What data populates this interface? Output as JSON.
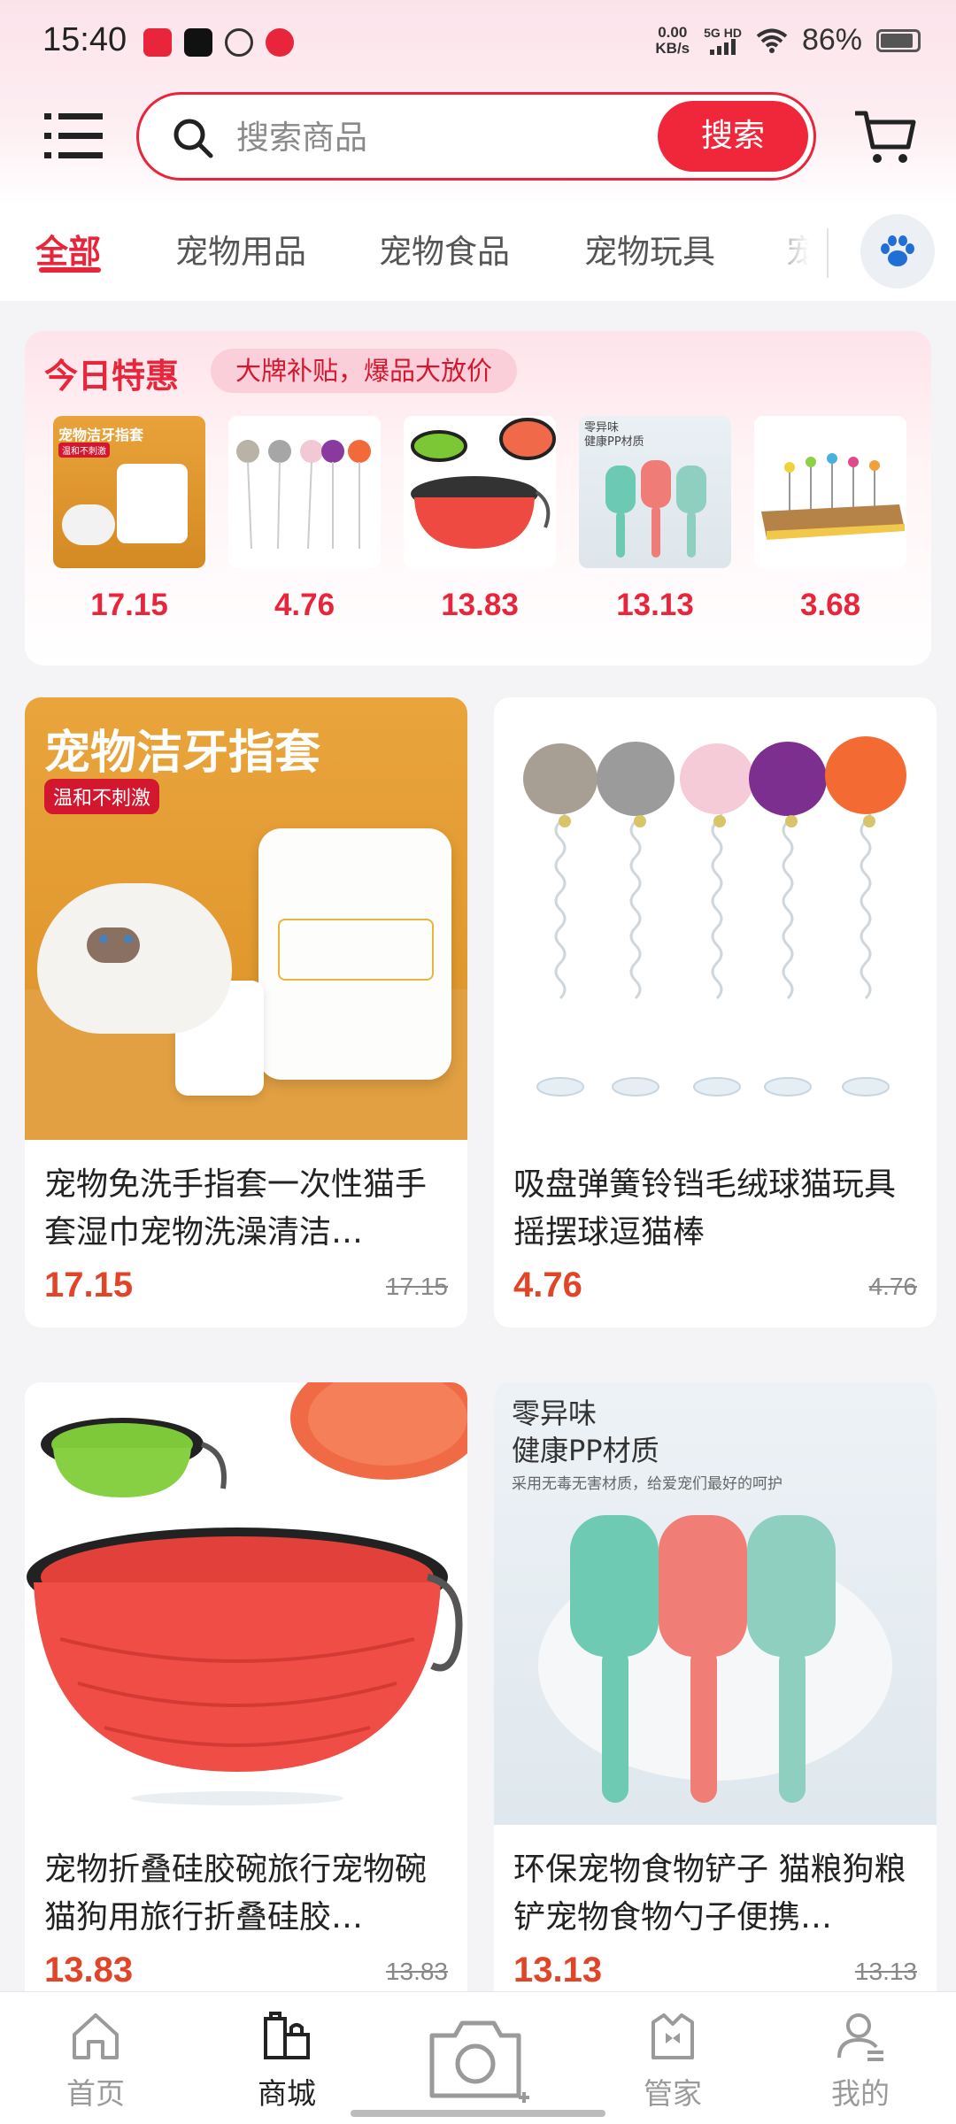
{
  "status_bar": {
    "time": "15:40",
    "net_speed_value": "0.00",
    "net_speed_unit": "KB/s",
    "network_type": "5G HD",
    "battery": "86%",
    "app_icons": [
      "xiaohongshu-icon",
      "douyin-icon",
      "wechat-icon",
      "heart-app-icon"
    ]
  },
  "header": {
    "menu_icon": "hamburger-menu-icon",
    "search_placeholder": "搜索商品",
    "search_button": "搜索",
    "cart_icon": "cart-icon"
  },
  "tabs": {
    "items": [
      "全部",
      "宠物用品",
      "宠物食品",
      "宠物玩具",
      "宠"
    ],
    "active_index": 0,
    "paw_icon": "paw-icon"
  },
  "deals": {
    "title": "今日特惠",
    "tagline": "大牌补贴，爆品大放价",
    "items": [
      {
        "thumb_caption": "宠物洁牙指套",
        "thumb_badge": "温和不刺激",
        "price": "17.15"
      },
      {
        "price": "4.76"
      },
      {
        "price": "13.83"
      },
      {
        "thumb_caption": "零异味",
        "thumb_caption2": "健康PP材质",
        "price": "13.13"
      },
      {
        "price": "3.68"
      }
    ]
  },
  "products": [
    {
      "img_title": "宠物洁牙指套",
      "img_badge": "温和不刺激",
      "title": "宠物免洗手指套一次性猫手套湿巾宠物洗澡清洁…",
      "price": "17.15",
      "original_price": "17.15"
    },
    {
      "title": "吸盘弹簧铃铛毛绒球猫玩具 摇摆球逗猫棒",
      "price": "4.76",
      "original_price": "4.76"
    },
    {
      "title": "宠物折叠硅胶碗旅行宠物碗猫狗用旅行折叠硅胶…",
      "price": "13.83",
      "original_price": "13.83"
    },
    {
      "img_title": "零异味",
      "img_title2": "健康PP材质",
      "img_sub": "采用无毒无害材质，给爱宠们最好的呵护",
      "title": "环保宠物食物铲子 猫粮狗粮铲宠物食物勺子便携…",
      "price": "13.13",
      "original_price": "13.13"
    }
  ],
  "bottom_nav": {
    "items": [
      {
        "label": "首页",
        "icon": "home-icon"
      },
      {
        "label": "商城",
        "icon": "shop-icon"
      },
      {
        "label": "",
        "icon": "camera-icon"
      },
      {
        "label": "管家",
        "icon": "butler-icon"
      },
      {
        "label": "我的",
        "icon": "profile-icon"
      }
    ],
    "active_index": 1
  },
  "colors": {
    "accent": "#e8253b",
    "price_red": "#e24428"
  }
}
